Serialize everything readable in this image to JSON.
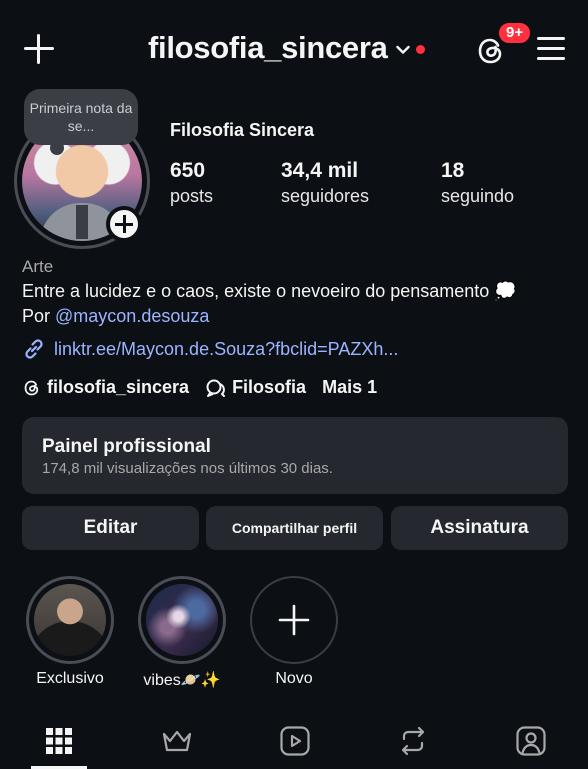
{
  "header": {
    "username": "filosofia_sincera",
    "badge": "9+"
  },
  "profile": {
    "note": "Primeira nota da se...",
    "display_name": "Filosofia Sincera",
    "stats": [
      {
        "value": "650",
        "label": "posts"
      },
      {
        "value": "34,4 mil",
        "label": "seguidores"
      },
      {
        "value": "18",
        "label": "seguindo"
      }
    ],
    "category": "Arte",
    "bio_line1": "Entre a lucidez e o caos, existe o nevoeiro do pensamento 💭",
    "bio_prefix": "Por ",
    "bio_mention": "@maycon.desouza",
    "link": "linktr.ee/Maycon.de.Souza?fbclid=PAZXh..."
  },
  "chips": {
    "threads": "filosofia_sincera",
    "channel": "Filosofia",
    "more": "Mais 1"
  },
  "panel": {
    "title": "Painel profissional",
    "subtitle": "174,8 mil visualizações nos últimos 30 dias."
  },
  "buttons": {
    "edit": "Editar",
    "share": "Compartilhar perfil",
    "subscription": "Assinatura"
  },
  "highlights": [
    {
      "label": "Exclusivo"
    },
    {
      "label": "vibes🪐✨"
    },
    {
      "label": "Novo"
    }
  ],
  "colors": {
    "background": "#0c1014",
    "card": "#25282e",
    "accent_link": "#9bb4ff",
    "notification": "#ff3040"
  },
  "icons": [
    "plus-icon",
    "chevron-down-icon",
    "threads-icon",
    "menu-icon",
    "link-icon",
    "grid-icon",
    "crown-icon",
    "reels-icon",
    "reposts-icon",
    "tagged-icon"
  ]
}
